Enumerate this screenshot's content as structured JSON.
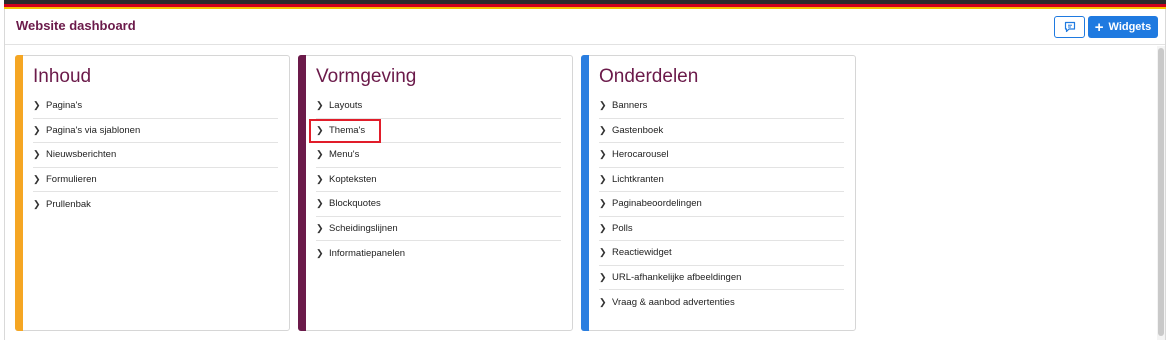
{
  "header": {
    "title": "Website dashboard",
    "widgets_label": "Widgets",
    "feedback_icon": "comment-icon",
    "plus_icon": "plus-icon"
  },
  "colors": {
    "inhoud": "#f5a623",
    "vormgeving": "#6b1a4a",
    "onderdelen": "#2a7ee0",
    "primary": "#1f7ae0",
    "highlight": "#e11d2a"
  },
  "cards": [
    {
      "title": "Inhoud",
      "items": [
        "Pagina's",
        "Pagina's via sjablonen",
        "Nieuwsberichten",
        "Formulieren",
        "Prullenbak"
      ]
    },
    {
      "title": "Vormgeving",
      "items": [
        "Layouts",
        "Thema's",
        "Menu's",
        "Kopteksten",
        "Blockquotes",
        "Scheidingslijnen",
        "Informatiepanelen"
      ]
    },
    {
      "title": "Onderdelen",
      "items": [
        "Banners",
        "Gastenboek",
        "Herocarousel",
        "Lichtkranten",
        "Paginabeoordelingen",
        "Polls",
        "Reactiewidget",
        "URL-afhankelijke afbeeldingen",
        "Vraag & aanbod advertenties"
      ]
    }
  ]
}
